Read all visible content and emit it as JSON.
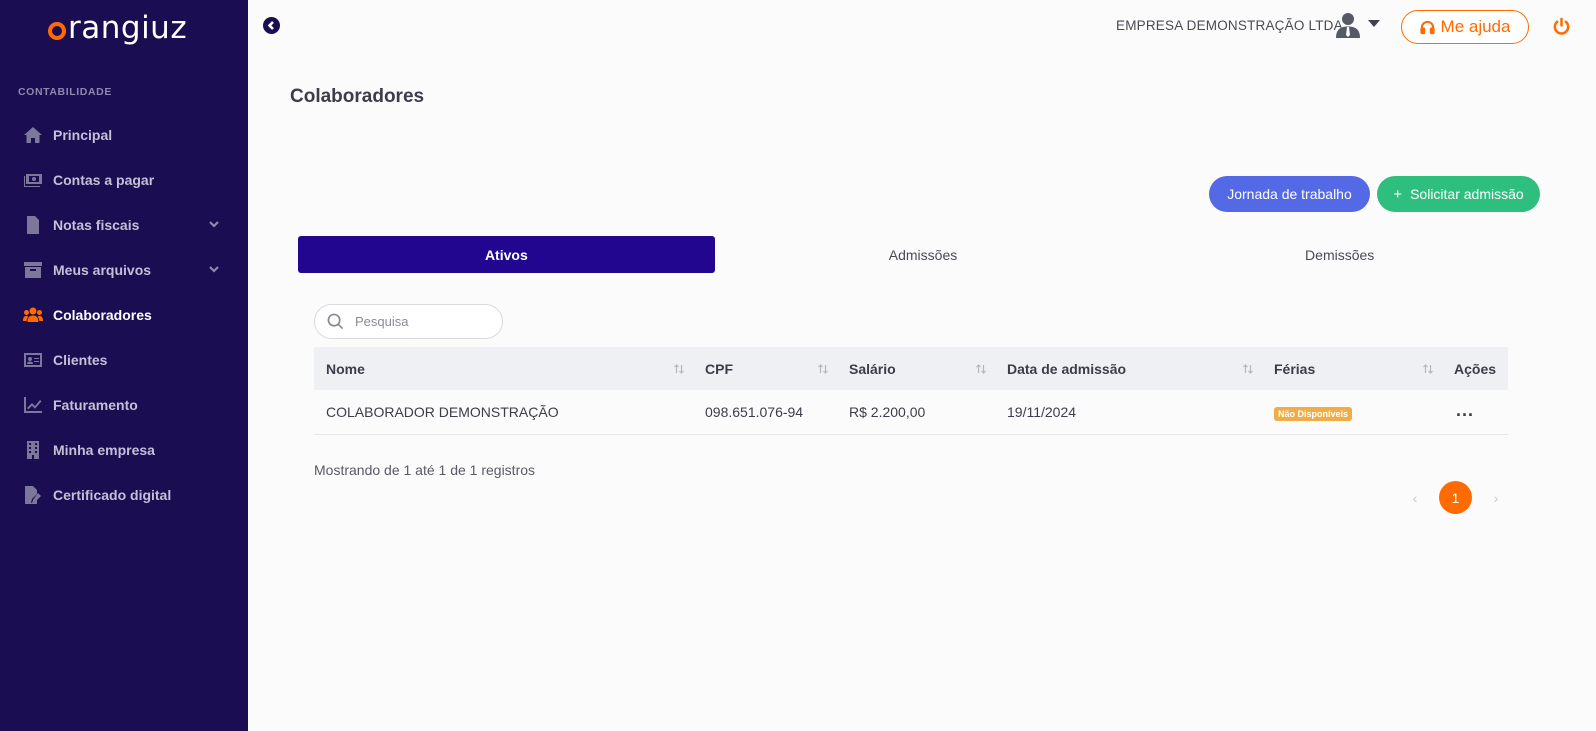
{
  "app": {
    "logo_text": "rangiuz"
  },
  "sidebar": {
    "section_label": "CONTABILIDADE",
    "items": [
      {
        "label": "Principal",
        "icon": "home-icon"
      },
      {
        "label": "Contas a pagar",
        "icon": "money-bill-icon"
      },
      {
        "label": "Notas fiscais",
        "icon": "file-invoice-icon",
        "expandable": true
      },
      {
        "label": "Meus arquivos",
        "icon": "archive-box-icon",
        "expandable": true
      },
      {
        "label": "Colaboradores",
        "icon": "users-icon",
        "active": true
      },
      {
        "label": "Clientes",
        "icon": "id-card-icon"
      },
      {
        "label": "Faturamento",
        "icon": "line-chart-icon"
      },
      {
        "label": "Minha empresa",
        "icon": "building-icon"
      },
      {
        "label": "Certificado digital",
        "icon": "file-signature-icon"
      }
    ]
  },
  "header": {
    "company": "EMPRESA DEMONSTRAÇÃO LTDA",
    "help_label": "Me ajuda"
  },
  "page": {
    "title": "Colaboradores",
    "btn_jornada": "Jornada de trabalho",
    "btn_admissao": "Solicitar admissão",
    "btn_admissao_prefix": "+"
  },
  "tabs": [
    {
      "label": "Ativos",
      "active": true
    },
    {
      "label": "Admissões",
      "active": false
    },
    {
      "label": "Demissões",
      "active": false
    }
  ],
  "search": {
    "placeholder": "Pesquisa",
    "value": ""
  },
  "table": {
    "columns": [
      "Nome",
      "CPF",
      "Salário",
      "Data de admissão",
      "Férias",
      "Ações"
    ],
    "rows": [
      {
        "nome": "COLABORADOR DEMONSTRAÇÃO",
        "cpf": "098.651.076-94",
        "salario": "R$ 2.200,00",
        "data_admissao": "19/11/2024",
        "ferias": "Não Disponíveis",
        "acoes": "..."
      }
    ],
    "info": "Mostrando de 1 até 1 de 1 registros"
  },
  "pagination": {
    "current": "1",
    "prev": "‹",
    "next": "›"
  },
  "colors": {
    "sidebar_bg": "#1b0d52",
    "accent": "#ff6b00",
    "tab_active": "#22068f",
    "btn_blue": "#5469e6",
    "btn_green": "#2ebf7e",
    "badge": "#f0ac46"
  }
}
